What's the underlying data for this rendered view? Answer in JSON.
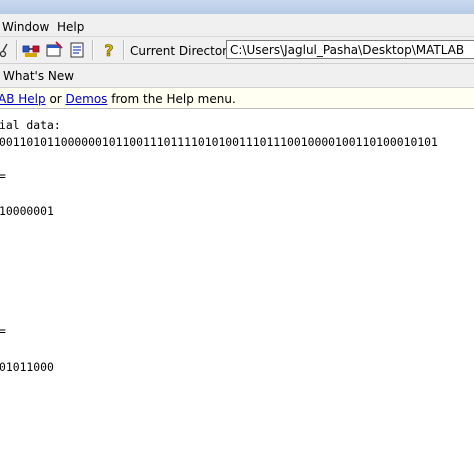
{
  "menu": {
    "items": [
      "Window",
      "Help"
    ]
  },
  "toolbar": {
    "current_directory_label": "Current Directory:",
    "current_directory_value": "C:\\Users\\Jaglul_Pasha\\Desktop\\MATLAB",
    "icons": [
      "scissors-icon",
      "simulink-icon",
      "guide-icon",
      "profiler-icon",
      "help-icon"
    ]
  },
  "shortcuts": {
    "whats_new": "What's New"
  },
  "help_line": {
    "link1": "AB Help",
    "text1": " or ",
    "link2": "Demos",
    "text2": " from the Help menu."
  },
  "command_window": {
    "lines": [
      "ial data:",
      "0011010110000001011001110111101010011101110010000100110100010101",
      "=",
      "10000001",
      "=",
      "01011000"
    ]
  }
}
